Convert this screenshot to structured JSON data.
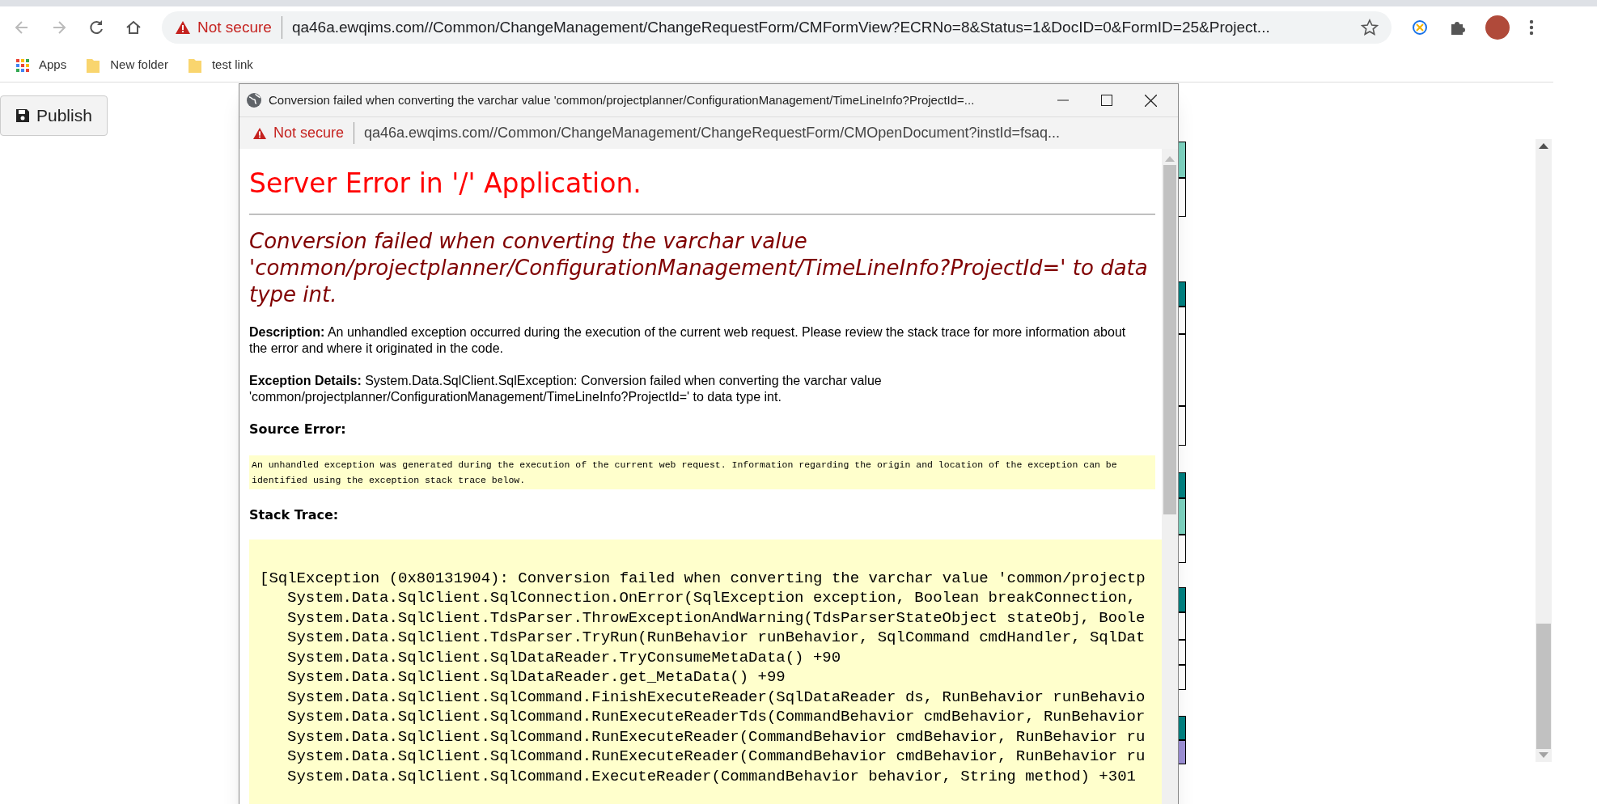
{
  "browser": {
    "security": "Not secure",
    "url": "qa46a.ewqims.com//Common/ChangeManagement/ChangeRequestForm/CMFormView?ECRNo=8&Status=1&DocID=0&FormID=25&Project...",
    "bookmarks": [
      {
        "label": "Apps",
        "kind": "apps"
      },
      {
        "label": "New folder",
        "kind": "folder"
      },
      {
        "label": "test link",
        "kind": "folder"
      }
    ]
  },
  "page": {
    "publish_button": "Publish"
  },
  "popup": {
    "title": "Conversion failed when converting the varchar value 'common/projectplanner/ConfigurationManagement/TimeLineInfo?ProjectId=...",
    "security": "Not secure",
    "url": "qa46a.ewqims.com//Common/ChangeManagement/ChangeRequestForm/CMOpenDocument?instId=fsaq...",
    "error_title": "Server Error in '/' Application.",
    "error_message": "Conversion failed when converting the varchar value 'common/projectplanner/ConfigurationManagement/TimeLineInfo?ProjectId=' to data type int.",
    "description": "**Description:** An unhandled exception occurred during the execution of the current web request. Please review the stack trace for more information about the error and where it originated in the code.",
    "exception_details": "**Exception Details:** System.Data.SqlClient.SqlException: Conversion failed when converting the varchar value\n'common/projectplanner/ConfigurationManagement/TimeLineInfo?ProjectId=' to data type int.",
    "source_error_label": "Source Error:",
    "source_error": "An unhandled exception was generated during the execution of the current web request. Information regarding the origin and location of the exception can be identified using the exception stack trace below.",
    "stack_trace_label": "Stack Trace:",
    "stack_trace": [
      {
        "kind": "header",
        "text": "[SqlException (0x80131904): Conversion failed when converting the varchar value 'common/projectp"
      },
      {
        "kind": "frame",
        "text": "System.Data.SqlClient.SqlConnection.OnError(SqlException exception, Boolean breakConnection,"
      },
      {
        "kind": "frame",
        "text": "System.Data.SqlClient.TdsParser.ThrowExceptionAndWarning(TdsParserStateObject stateObj, Boole"
      },
      {
        "kind": "frame",
        "text": "System.Data.SqlClient.TdsParser.TryRun(RunBehavior runBehavior, SqlCommand cmdHandler, SqlDat"
      },
      {
        "kind": "frame",
        "text": "System.Data.SqlClient.SqlDataReader.TryConsumeMetaData() +90"
      },
      {
        "kind": "frame",
        "text": "System.Data.SqlClient.SqlDataReader.get_MetaData() +99"
      },
      {
        "kind": "frame",
        "text": "System.Data.SqlClient.SqlCommand.FinishExecuteReader(SqlDataReader ds, RunBehavior runBehavio"
      },
      {
        "kind": "frame",
        "text": "System.Data.SqlClient.SqlCommand.RunExecuteReaderTds(CommandBehavior cmdBehavior, RunBehavior"
      },
      {
        "kind": "frame",
        "text": "System.Data.SqlClient.SqlCommand.RunExecuteReader(CommandBehavior cmdBehavior, RunBehavior ru"
      },
      {
        "kind": "frame",
        "text": "System.Data.SqlClient.SqlCommand.RunExecuteReader(CommandBehavior cmdBehavior, RunBehavior ru"
      },
      {
        "kind": "frame",
        "text": "System.Data.SqlClient.SqlCommand.ExecuteReader(CommandBehavior behavior, String method) +301"
      }
    ]
  }
}
